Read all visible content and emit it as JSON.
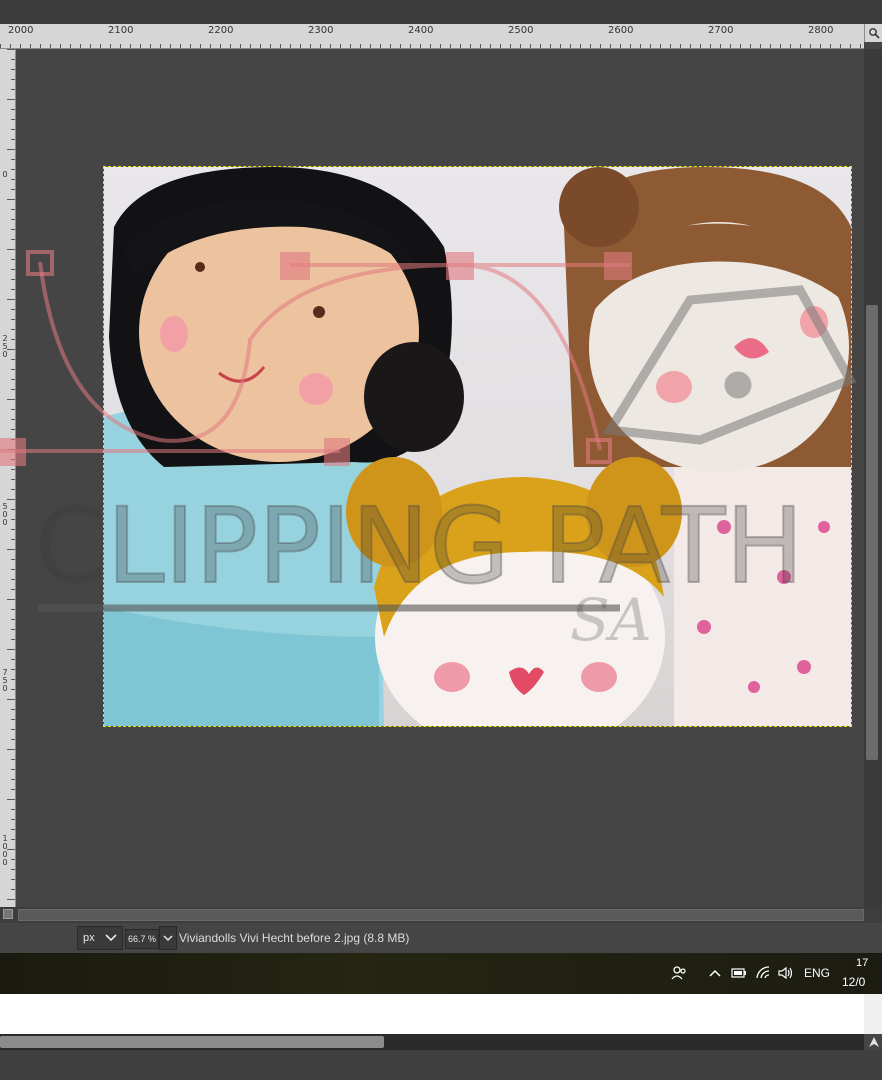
{
  "ruler": {
    "h_labels": [
      "2000",
      "2100",
      "2200",
      "2300",
      "2400",
      "2500",
      "2600",
      "2700",
      "2800"
    ],
    "v_labels": [
      "0",
      "250",
      "500",
      "750",
      "1000"
    ]
  },
  "statusbar": {
    "unit": "px",
    "zoom": "66.7 %",
    "filename": "Viviandolls Vivi Hecht before 2.jpg (8.8 MB)"
  },
  "taskbar": {
    "language": "ENG",
    "time": "17",
    "date": "12/0"
  },
  "watermark": {
    "line1": "CLIPPING PATH",
    "line2": "SA"
  },
  "icons": {
    "zoom_fit": "magnifier-icon",
    "people": "people-icon",
    "tray_up": "chevron-up-icon",
    "battery": "battery-icon",
    "wifi": "wifi-icon",
    "volume": "volume-icon"
  },
  "colors": {
    "selection_border": "#e6e600",
    "canvas_bg": "#454545",
    "ruler_bg": "#d6d6d6"
  }
}
